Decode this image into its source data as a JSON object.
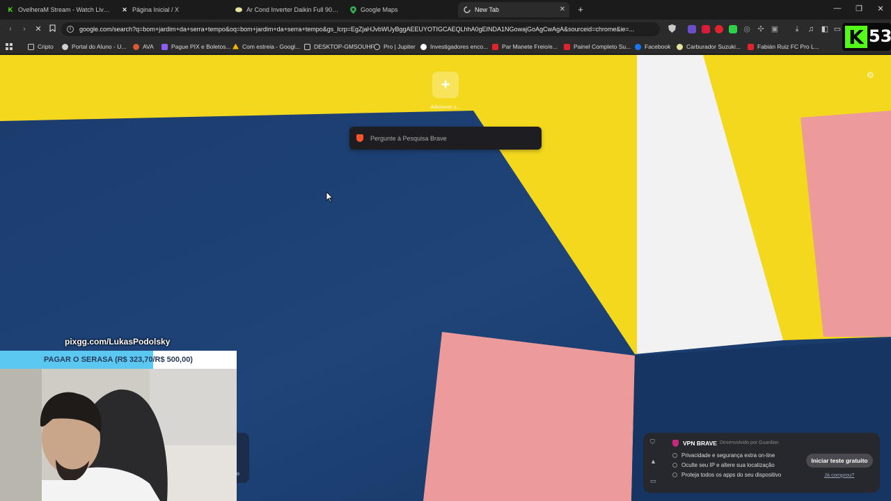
{
  "tabs": [
    {
      "title": "OvelheraM Stream - Watch Live on K",
      "favicon": "kick-icon",
      "color": "#53fc18"
    },
    {
      "title": "Página Inicial / X",
      "favicon": "x-icon",
      "color": "#e8e8e8"
    },
    {
      "title": "Ar Cond Inverter Daikin Full 9000 Btu",
      "favicon": "store-icon",
      "color": "#e6e2a0"
    },
    {
      "title": "Google Maps",
      "favicon": "maps-pin-icon",
      "color": "#34a853"
    },
    {
      "title": "New Tab",
      "favicon": "loading-icon",
      "color": "#bbbbbb",
      "active": true
    }
  ],
  "url": "google.com/search?q=bom+jardim+da+serra+tempo&oq=bom+jardim+da+serra+tempo&gs_lcrp=EgZjaHJvbWUyBggAEEUYOTIGCAEQLhhA0gEINDA1NGowajGoAgCwAgA&sourceid=chrome&ie=...",
  "bookmarks": [
    {
      "label": "Cripto",
      "icon": "folder-icon",
      "color": "#cfcfcf"
    },
    {
      "label": "Portal do Aluno - U...",
      "icon": "globe-icon",
      "color": "#cfcfcf"
    },
    {
      "label": "AVA",
      "icon": "ava-icon",
      "color": "#d85a30"
    },
    {
      "label": "Pague PIX e Boletos...",
      "icon": "pix-icon",
      "color": "#8b5cf6"
    },
    {
      "label": "Com estreia - Googl...",
      "icon": "drive-icon",
      "color": "#f4b400"
    },
    {
      "label": "DESKTOP-GMSOUHF",
      "icon": "folder-icon",
      "color": "#cfcfcf"
    },
    {
      "label": "Pro | Jupiter",
      "icon": "jupiter-icon",
      "color": "#cfcfcf"
    },
    {
      "label": "Investigadores enco...",
      "icon": "google-icon",
      "color": "#ffffff"
    },
    {
      "label": "Par Manete Freio/e...",
      "icon": "store-icon",
      "color": "#e0242b"
    },
    {
      "label": "Painel Completo Su...",
      "icon": "store-icon",
      "color": "#e0242b"
    },
    {
      "label": "Facebook",
      "icon": "facebook-icon",
      "color": "#1877f2"
    },
    {
      "label": "Carburador Suzuki...",
      "icon": "store-icon",
      "color": "#e6e2a0"
    },
    {
      "label": "Fabián Ruiz FC Pro L...",
      "icon": "store-icon",
      "color": "#e0242b"
    }
  ],
  "newtab": {
    "add_label": "Adicionar s...",
    "search_placeholder": "Pergunte à Pesquisa Brave"
  },
  "stream_overlay": {
    "pix_link": "pixgg.com/LukasPodolsky",
    "goal_text": "PAGAR O SERASA (R$ 323,70/R$ 500,00)",
    "goal_progress": 0.647,
    "cam_edge_text": "o"
  },
  "vpn": {
    "title": "VPN BRAVE",
    "by": "Desenvolvido por Guardian",
    "features": [
      "Privacidade e segurança extra on-line",
      "Oculte seu IP e altere sua localização",
      "Proteja todos os apps do seu dispositivo"
    ],
    "cta": "Iniciar teste gratuito",
    "already": "Já comprou?"
  },
  "kick_badge": {
    "letter": "K",
    "number": "53"
  },
  "colors": {
    "wall_yellow": "#f4d81e",
    "wall_blue": "#1b3a6b",
    "wall_pink": "#ec9a9a",
    "wall_white": "#f2f2f2",
    "brave_orange": "#fb542b",
    "kick_green": "#53fc18"
  }
}
